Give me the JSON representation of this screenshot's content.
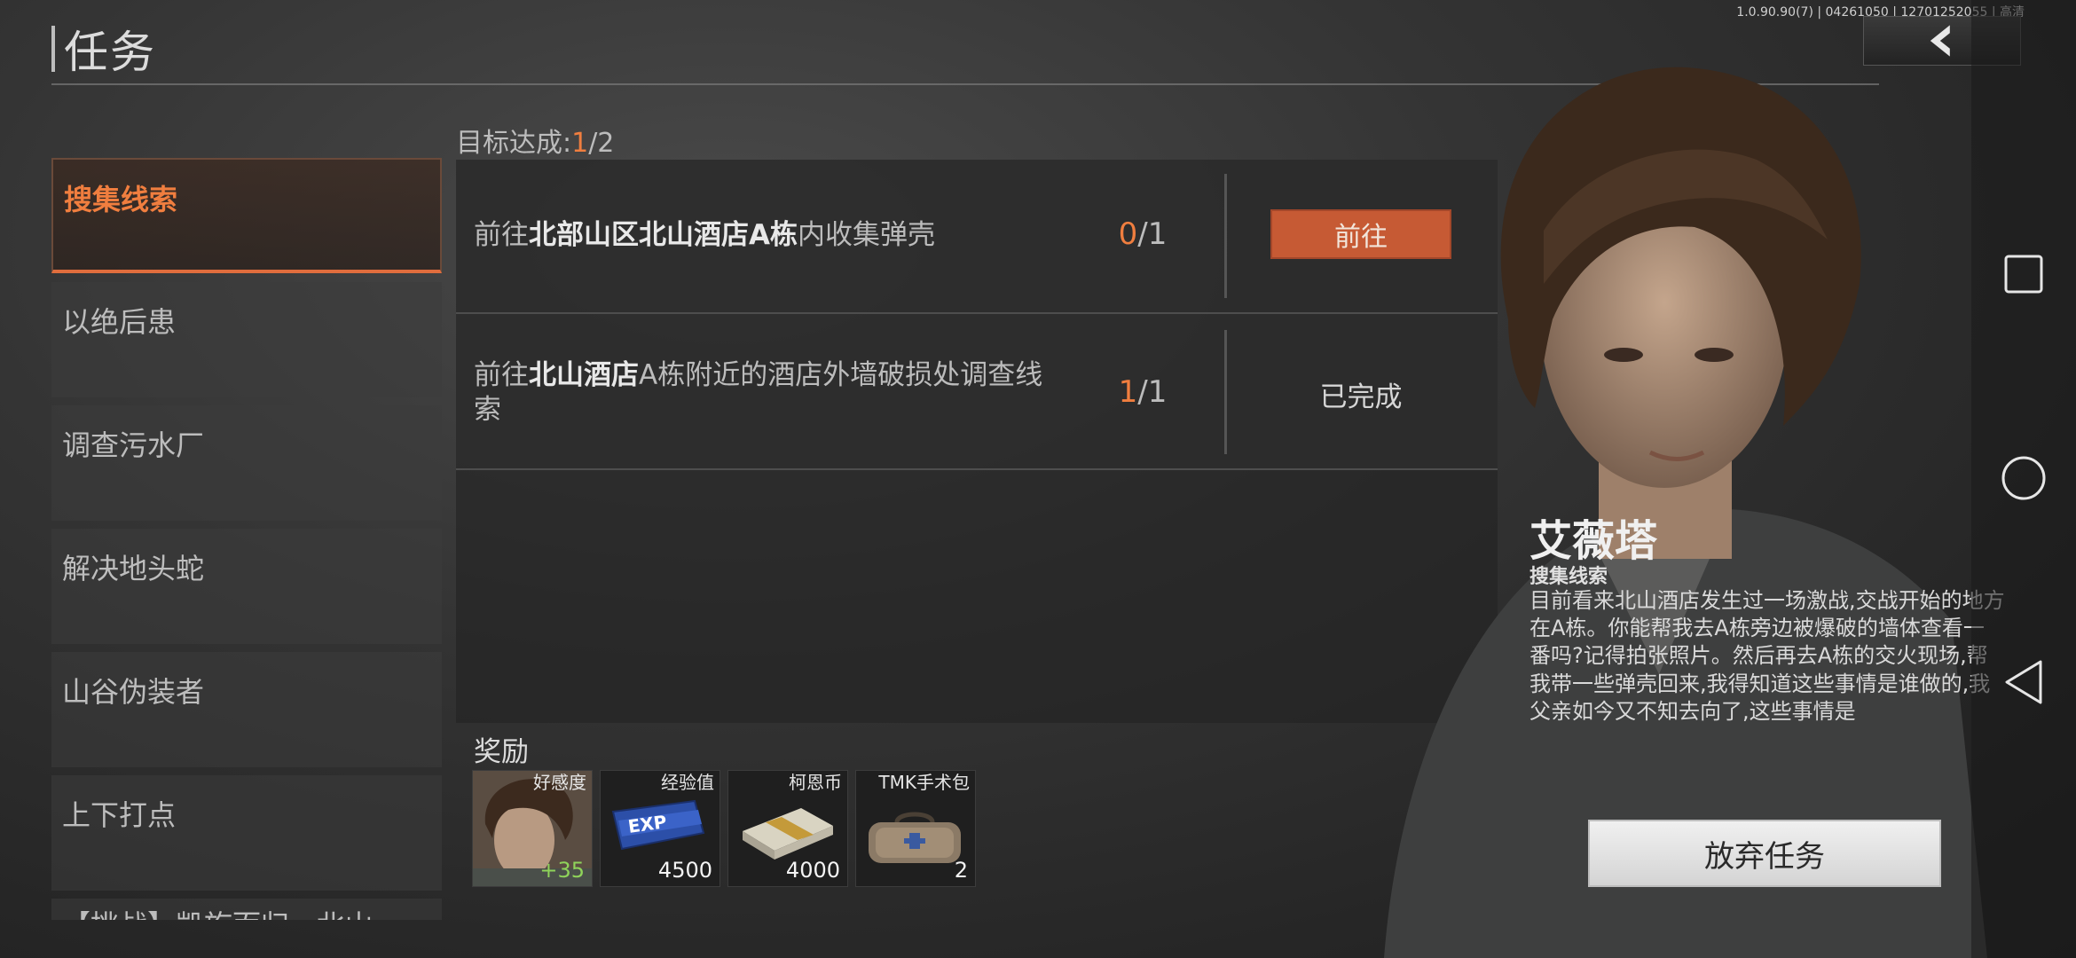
{
  "header": {
    "title": "任务",
    "version": "1.0.90.90(7) | 04261050 | 12701252055 | 高清"
  },
  "sidebar": {
    "items": [
      {
        "label": "搜集线索",
        "active": true
      },
      {
        "label": "以绝后患"
      },
      {
        "label": "调查污水厂"
      },
      {
        "label": "解决地头蛇"
      },
      {
        "label": "山谷伪装者"
      },
      {
        "label": "上下打点"
      },
      {
        "label": "【挑战】凯旋而归 · 北山"
      }
    ]
  },
  "goal": {
    "label": "目标达成:",
    "current": "1",
    "total": "/2"
  },
  "objectives": [
    {
      "parts": [
        {
          "text": "前往",
          "bold": false
        },
        {
          "text": "北部山区北山酒店A栋",
          "bold": true
        },
        {
          "text": "内收集弹壳",
          "bold": false
        }
      ],
      "progress_current": "0",
      "progress_total": "/1",
      "action": "前往"
    },
    {
      "parts": [
        {
          "text": "前往",
          "bold": false
        },
        {
          "text": "北山酒店",
          "bold": true
        },
        {
          "text": "A栋附近的酒店外墙破损处调查线索",
          "bold": false
        }
      ],
      "progress_current": "1",
      "progress_total": "/1",
      "status": "已完成"
    }
  ],
  "rewards": {
    "label": "奖励",
    "items": [
      {
        "name": "好感度",
        "value": "+35",
        "icon": "portrait-icon"
      },
      {
        "name": "经验值",
        "value": "4500",
        "icon": "exp-card-icon"
      },
      {
        "name": "柯恩币",
        "value": "4000",
        "icon": "cash-stack-icon"
      },
      {
        "name": "TMK手术包",
        "value": "2",
        "icon": "medical-bag-icon"
      }
    ]
  },
  "npc": {
    "name": "艾薇塔",
    "task": "搜集线索",
    "description": "目前看来北山酒店发生过一场激战,交战开始的地方在A栋。你能帮我去A栋旁边被爆破的墙体查看一番吗?记得拍张照片。然后再去A栋的交火现场,帮我带一些弹壳回来,我得知道这些事情是谁做的,我父亲如今又不知去向了,这些事情是"
  },
  "abandon_label": "放弃任务",
  "colors": {
    "accent": "#f07e3f",
    "button": "#c65a34"
  }
}
